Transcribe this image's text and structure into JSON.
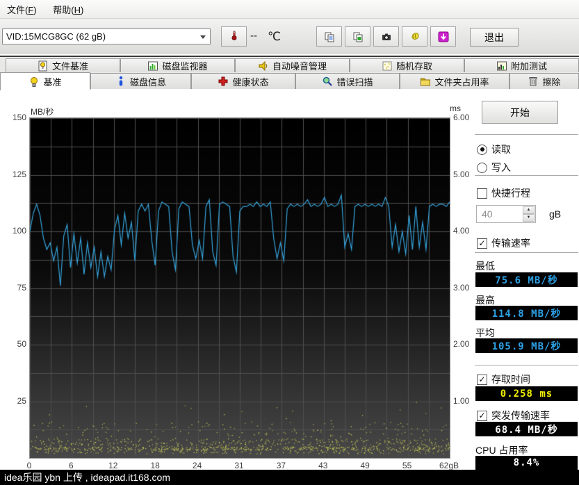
{
  "menu": {
    "items": [
      {
        "pre": "文件(",
        "key": "F",
        "suf": ")"
      },
      {
        "pre": "帮助(",
        "key": "H",
        "suf": ")"
      }
    ]
  },
  "toolbar": {
    "drive_select": "VID:15MCG8GC (62 gB)",
    "temp_value": "--",
    "temp_unit": "℃",
    "buttons": [
      {
        "id": "copy-report-button",
        "icon": "copy-report-icon"
      },
      {
        "id": "copy-image-button",
        "icon": "copy-image-icon"
      },
      {
        "id": "screenshot-button",
        "icon": "screenshot-icon"
      },
      {
        "id": "options-button",
        "icon": "options-icon"
      },
      {
        "id": "download-button",
        "icon": "download-icon"
      }
    ],
    "exit_label": "退出"
  },
  "tabs_row1": [
    {
      "id": "file-benchmark",
      "label": "文件基准",
      "icon": "file-benchmark-icon"
    },
    {
      "id": "disk-monitor",
      "label": "磁盘监视器",
      "icon": "disk-monitor-icon"
    },
    {
      "id": "aam",
      "label": "自动噪音管理",
      "icon": "speaker-icon"
    },
    {
      "id": "random-access",
      "label": "随机存取",
      "icon": "random-access-icon"
    },
    {
      "id": "extra-tests",
      "label": "附加测试",
      "icon": "extra-tests-icon"
    }
  ],
  "tabs_row2": [
    {
      "id": "benchmark",
      "label": "基准",
      "icon": "bulb-icon",
      "active": true
    },
    {
      "id": "disk-info",
      "label": "磁盘信息",
      "icon": "info-icon",
      "active": false
    },
    {
      "id": "health",
      "label": "健康状态",
      "icon": "health-cross-icon",
      "active": false
    },
    {
      "id": "error-scan",
      "label": "错误扫描",
      "icon": "magnifier-icon",
      "active": false
    },
    {
      "id": "folder-usage",
      "label": "文件夹占用率",
      "icon": "folder-icon",
      "active": false
    },
    {
      "id": "erase",
      "label": "擦除",
      "icon": "trash-icon",
      "active": false
    }
  ],
  "chart_data": {
    "type": "line",
    "left_axis_title": "MB/秒",
    "right_axis_title": "ms",
    "x_ticks": [
      "0",
      "6",
      "12",
      "18",
      "24",
      "31",
      "37",
      "43",
      "49",
      "55",
      "62gB"
    ],
    "y_left_ticks": [
      "150",
      "125",
      "100",
      "75",
      "50",
      "25"
    ],
    "y_right_ticks": [
      "6.00",
      "5.00",
      "4.00",
      "3.00",
      "2.00",
      "1.00"
    ],
    "x_range_gb": [
      0,
      62
    ],
    "y_left_range": [
      0,
      150
    ],
    "y_right_range": [
      0,
      6
    ],
    "grid": true,
    "plot_colors": {
      "bg_top": "#000000",
      "bg_bottom": "#484848",
      "grid": "#4f4f4f",
      "border": "#8c8c8c",
      "line": "#35a3dc",
      "dots": "#d6d65a"
    },
    "series": [
      {
        "name": "transfer-rate",
        "unit": "MB/秒",
        "x_step_gb": 0.5,
        "values": [
          100,
          108,
          112,
          107,
          97,
          92,
          95,
          87,
          93,
          76,
          98,
          103,
          84,
          99,
          86,
          97,
          81,
          95,
          84,
          93,
          80,
          91,
          80,
          89,
          83,
          101,
          107,
          94,
          108,
          97,
          104,
          87,
          109,
          112,
          109,
          112,
          96,
          85,
          109,
          113,
          112,
          111,
          91,
          83,
          110,
          113,
          112,
          111,
          94,
          88,
          96,
          88,
          111,
          114,
          91,
          85,
          112,
          113,
          112,
          111,
          89,
          82,
          109,
          111,
          111,
          112,
          111,
          113,
          111,
          112,
          111,
          113,
          97,
          88,
          95,
          87,
          110,
          112,
          111,
          112,
          111,
          112,
          114,
          111,
          112,
          111,
          112,
          115,
          111,
          112,
          111,
          112,
          116,
          93,
          99,
          92,
          111,
          112,
          111,
          112,
          111,
          112,
          111,
          112,
          111,
          115,
          111,
          93,
          103,
          91,
          100,
          90,
          107,
          92,
          111,
          93,
          104,
          92,
          111,
          112,
          111,
          112,
          112,
          111,
          113
        ]
      },
      {
        "name": "access-time-scatter",
        "unit": "ms",
        "type": "scatter-band",
        "seed": 1337,
        "band_ms": [
          0.14,
          0.2
        ],
        "band_count": 300,
        "dense_ms": [
          0.08,
          0.34
        ],
        "dense_count": 600,
        "mid_ms": [
          0.3,
          0.65
        ],
        "mid_count": 160,
        "outlier_ms": [
          0.65,
          1.0
        ],
        "outlier_count": 15
      }
    ]
  },
  "panel": {
    "start_label": "开始",
    "mode_options": [
      {
        "label": "读取",
        "selected": true
      },
      {
        "label": "写入",
        "selected": false
      }
    ],
    "short_stroke": {
      "label": "快捷行程",
      "checked": false,
      "value": "40",
      "unit": "gB"
    },
    "transfer_rate": {
      "label": "传输速率",
      "checked": true
    },
    "stats": [
      {
        "label": "最低",
        "value": "75.6 MB/秒",
        "color": "#2da2e8"
      },
      {
        "label": "最高",
        "value": "114.8 MB/秒",
        "color": "#2da2e8"
      },
      {
        "label": "平均",
        "value": "105.9 MB/秒",
        "color": "#2da2e8"
      }
    ],
    "access_time": {
      "label": "存取时间",
      "checked": true,
      "value": "0.258 ms",
      "color": "#f0f000"
    },
    "burst_rate": {
      "label": "突发传输速率",
      "checked": true,
      "value": "68.4 MB/秒",
      "color": "#ffffff"
    },
    "cpu": {
      "label": "CPU 占用率",
      "value": "8.4%",
      "color": "#ffffff"
    }
  },
  "statusbar": {
    "text": "idea乐园 ybn 上传 , ideapad.it168.com"
  }
}
